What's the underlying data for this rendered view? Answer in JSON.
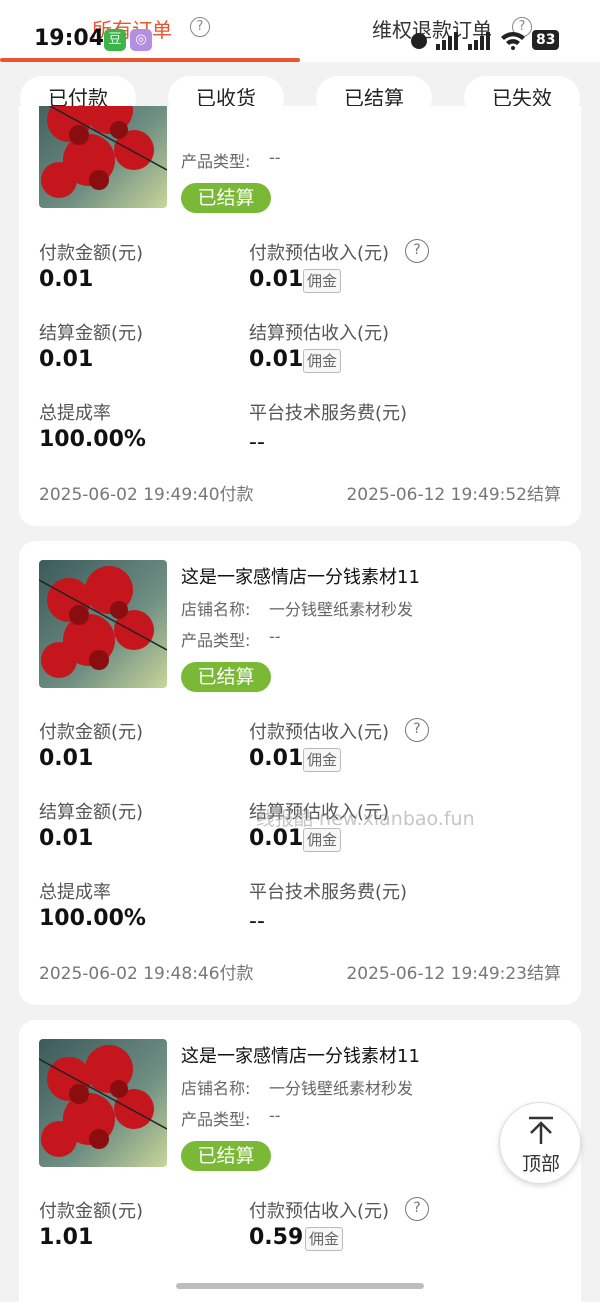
{
  "status_bar": {
    "time": "19:04",
    "app1": "豆",
    "app2": "◎",
    "battery": "83"
  },
  "header_tabs": {
    "all_orders": "所有订单",
    "refund_orders": "维权退款订单",
    "help": "?"
  },
  "filters": [
    "已付款",
    "已收货",
    "已结算",
    "已失效"
  ],
  "labels": {
    "pay_amount": "付款金额(元)",
    "pay_income": "付款预估收入(元)",
    "settle_amount": "结算金额(元)",
    "settle_income": "结算预估收入(元)",
    "commission_rate": "总提成率",
    "service_fee": "平台技术服务费(元)",
    "shop_prefix": "店铺名称:",
    "type_prefix": "产品类型:",
    "commission_badge": "佣金",
    "help": "?"
  },
  "orders": [
    {
      "title": "",
      "shop": "",
      "type": "--",
      "status": "已结算",
      "pay_amount": "0.01",
      "pay_income": "0.01",
      "settle_amount": "0.01",
      "settle_income": "0.01",
      "commission_rate": "100.00%",
      "service_fee": "--",
      "pay_time": "2025-06-02 19:49:40付款",
      "settle_time": "2025-06-12 19:49:52结算"
    },
    {
      "title": "这是一家感情店一分钱素材11",
      "shop": "一分钱壁纸素材秒发",
      "type": "--",
      "status": "已结算",
      "pay_amount": "0.01",
      "pay_income": "0.01",
      "settle_amount": "0.01",
      "settle_income": "0.01",
      "commission_rate": "100.00%",
      "service_fee": "--",
      "pay_time": "2025-06-02 19:48:46付款",
      "settle_time": "2025-06-12 19:49:23结算"
    },
    {
      "title": "这是一家感情店一分钱素材11",
      "shop": "一分钱壁纸素材秒发",
      "type": "--",
      "status": "已结算",
      "pay_amount": "1.01",
      "pay_income": "0.59"
    }
  ],
  "watermark": "线报酷 new.xianbao.fun",
  "back_to_top": "顶部",
  "colors": {
    "accent": "#e8552e",
    "status_green": "#7ab935"
  }
}
